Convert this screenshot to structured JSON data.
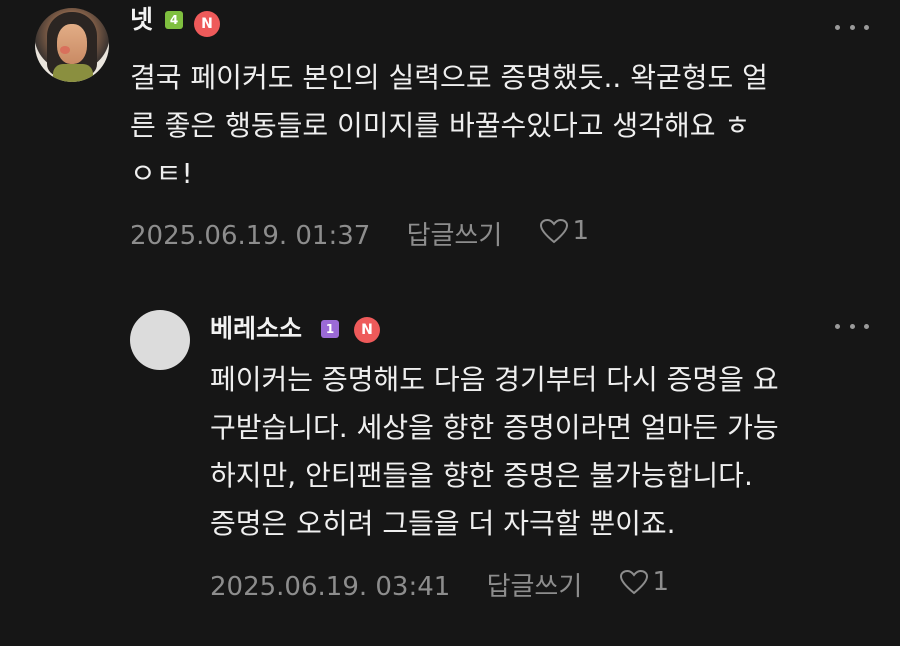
{
  "comments": [
    {
      "author": "넷",
      "level": "4",
      "level_color": "#7fbf3f",
      "badge": "N",
      "avatar_icon": "portrait-avatar",
      "more_icon": "more-dots-icon",
      "text": "결국 페이커도 본인의 실력으로 증명했듯.. 왁굳형도 얼\n른 좋은 행동들로 이미지를 바꿀수있다고 생각해요 ㅎ\nㅇㅌ!",
      "timestamp": "2025.06.19. 01:37",
      "reply_label": "답글쓰기",
      "like_count": "1"
    },
    {
      "author": "베레소소",
      "level": "1",
      "level_color": "#9b6ad6",
      "badge": "N",
      "avatar_icon": "default-avatar",
      "more_icon": "more-dots-icon",
      "text": "페이커는 증명해도 다음 경기부터 다시 증명을 요\n구받습니다. 세상을 향한 증명이라면 얼마든 가능\n하지만, 안티팬들을 향한 증명은 불가능합니다.\n증명은 오히려 그들을 더 자극할 뿐이죠.",
      "timestamp": "2025.06.19. 03:41",
      "reply_label": "답글쓰기",
      "like_count": "1"
    }
  ]
}
